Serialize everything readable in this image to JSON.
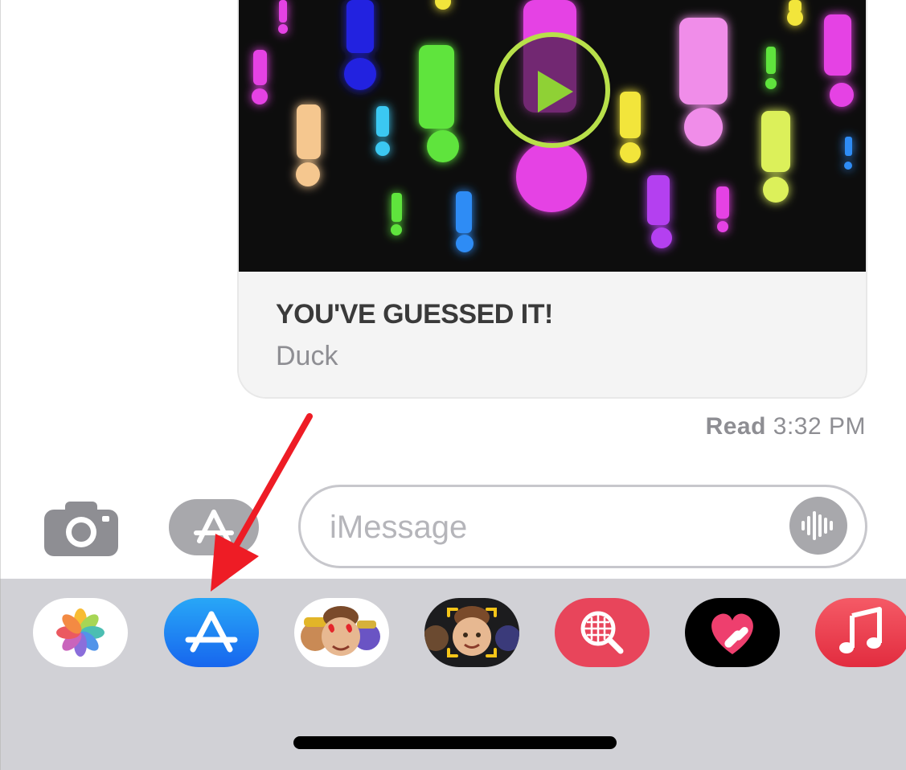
{
  "message_card": {
    "title": "YOU'VE GUESSED IT!",
    "subtitle": "Duck",
    "preview_icon": "play-icon"
  },
  "receipt": {
    "label": "Read",
    "time": "3:32 PM"
  },
  "composer": {
    "placeholder": "iMessage",
    "camera_icon": "camera-icon",
    "apps_icon": "app-store-icon",
    "audio_icon": "audio-waveform-icon"
  },
  "app_drawer": {
    "apps": [
      {
        "name": "Photos",
        "icon": "photos-icon"
      },
      {
        "name": "App Store",
        "icon": "app-store-icon"
      },
      {
        "name": "Memoji Stickers",
        "icon": "memoji-stickers-icon"
      },
      {
        "name": "Memoji",
        "icon": "memoji-camera-icon"
      },
      {
        "name": "Images",
        "icon": "image-search-icon"
      },
      {
        "name": "Digital Touch",
        "icon": "digital-touch-icon"
      },
      {
        "name": "Music",
        "icon": "music-icon"
      }
    ]
  },
  "colors": {
    "drawer_bg": "#d1d1d6",
    "app_store_blue": "#1b7bf2",
    "annotation_red": "#ee1c25",
    "play_ring": "#b8e04a"
  }
}
